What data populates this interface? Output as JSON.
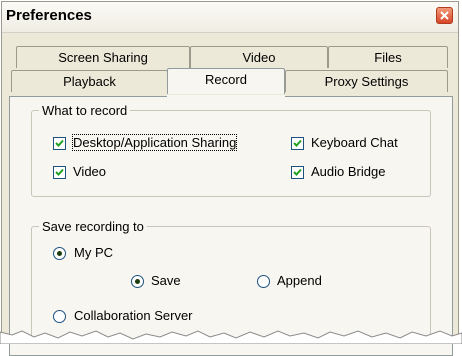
{
  "window": {
    "title": "Preferences",
    "close_icon": "close-icon"
  },
  "tabs": {
    "back_row": [
      {
        "label": "Screen Sharing"
      },
      {
        "label": "Video"
      },
      {
        "label": "Files"
      }
    ],
    "front_row": [
      {
        "label": "Playback"
      },
      {
        "label": "Record",
        "active": true
      },
      {
        "label": "Proxy Settings"
      }
    ]
  },
  "what_to_record": {
    "legend": "What to record",
    "desktop_sharing": {
      "label": "Desktop/Application Sharing",
      "checked": true
    },
    "video": {
      "label": "Video",
      "checked": true
    },
    "keyboard_chat": {
      "label": "Keyboard Chat",
      "checked": true
    },
    "audio_bridge": {
      "label": "Audio Bridge",
      "checked": true
    }
  },
  "save_recording": {
    "legend": "Save recording to",
    "my_pc": {
      "label": "My PC",
      "selected": true
    },
    "save": {
      "label": "Save",
      "selected": true
    },
    "append": {
      "label": "Append",
      "selected": false
    },
    "collaboration_server": {
      "label": "Collaboration Server",
      "selected": false
    }
  },
  "colors": {
    "window_bg": "#ece9d8",
    "panel_bg": "#f7f6f1",
    "check": "#21a121",
    "close": "#d8472a"
  }
}
